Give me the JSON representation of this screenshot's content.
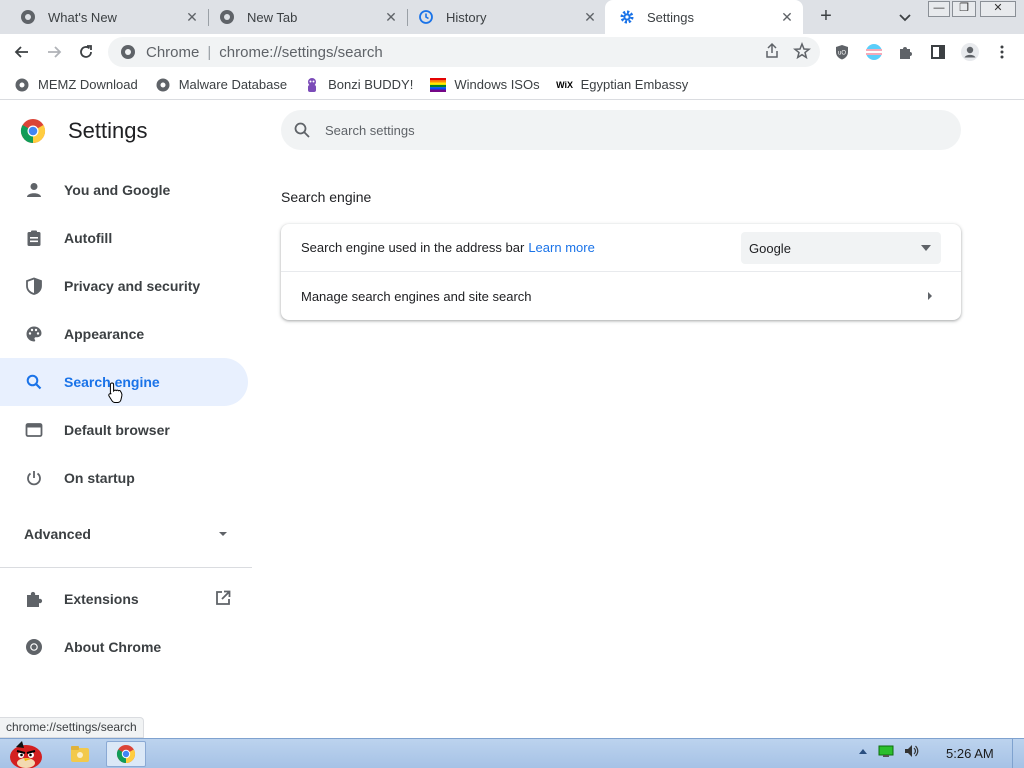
{
  "tabs": [
    {
      "title": "What's New",
      "icon": "chrome-logo-icon"
    },
    {
      "title": "New Tab",
      "icon": "chrome-logo-icon"
    },
    {
      "title": "History",
      "icon": "history-icon"
    },
    {
      "title": "Settings",
      "icon": "gear-icon",
      "active": true
    }
  ],
  "toolbar": {
    "site_label": "Chrome",
    "url": "chrome://settings/search"
  },
  "bookmarks": [
    {
      "label": "MEMZ Download",
      "icon": "globe-icon"
    },
    {
      "label": "Malware Database",
      "icon": "globe-icon"
    },
    {
      "label": "Bonzi BUDDY!",
      "icon": "bonzi-icon"
    },
    {
      "label": "Windows ISOs",
      "icon": "rainbow-flag-icon"
    },
    {
      "label": "Egyptian Embassy",
      "icon": "wix-icon",
      "icon_text": "WiX"
    }
  ],
  "settings": {
    "title": "Settings",
    "search_placeholder": "Search settings",
    "nav": [
      {
        "label": "You and Google",
        "icon": "person-icon"
      },
      {
        "label": "Autofill",
        "icon": "clipboard-icon"
      },
      {
        "label": "Privacy and security",
        "icon": "shield-icon"
      },
      {
        "label": "Appearance",
        "icon": "palette-icon"
      },
      {
        "label": "Search engine",
        "icon": "search-icon",
        "selected": true
      },
      {
        "label": "Default browser",
        "icon": "browser-window-icon"
      },
      {
        "label": "On startup",
        "icon": "power-icon"
      }
    ],
    "advanced_label": "Advanced",
    "nav_bottom": [
      {
        "label": "Extensions",
        "icon": "puzzle-icon"
      },
      {
        "label": "About Chrome",
        "icon": "chrome-logo-icon"
      }
    ],
    "section_title": "Search engine",
    "row1_label": "Search engine used in the address bar",
    "row1_link": "Learn more",
    "row1_value": "Google",
    "row2_label": "Manage search engines and site search"
  },
  "status_text": "chrome://settings/search",
  "taskbar": {
    "clock": "5:26 AM"
  },
  "colors": {
    "accent": "#1a73e8",
    "selected_bg": "#e8f0fe",
    "tabstrip": "#dee1e6"
  }
}
